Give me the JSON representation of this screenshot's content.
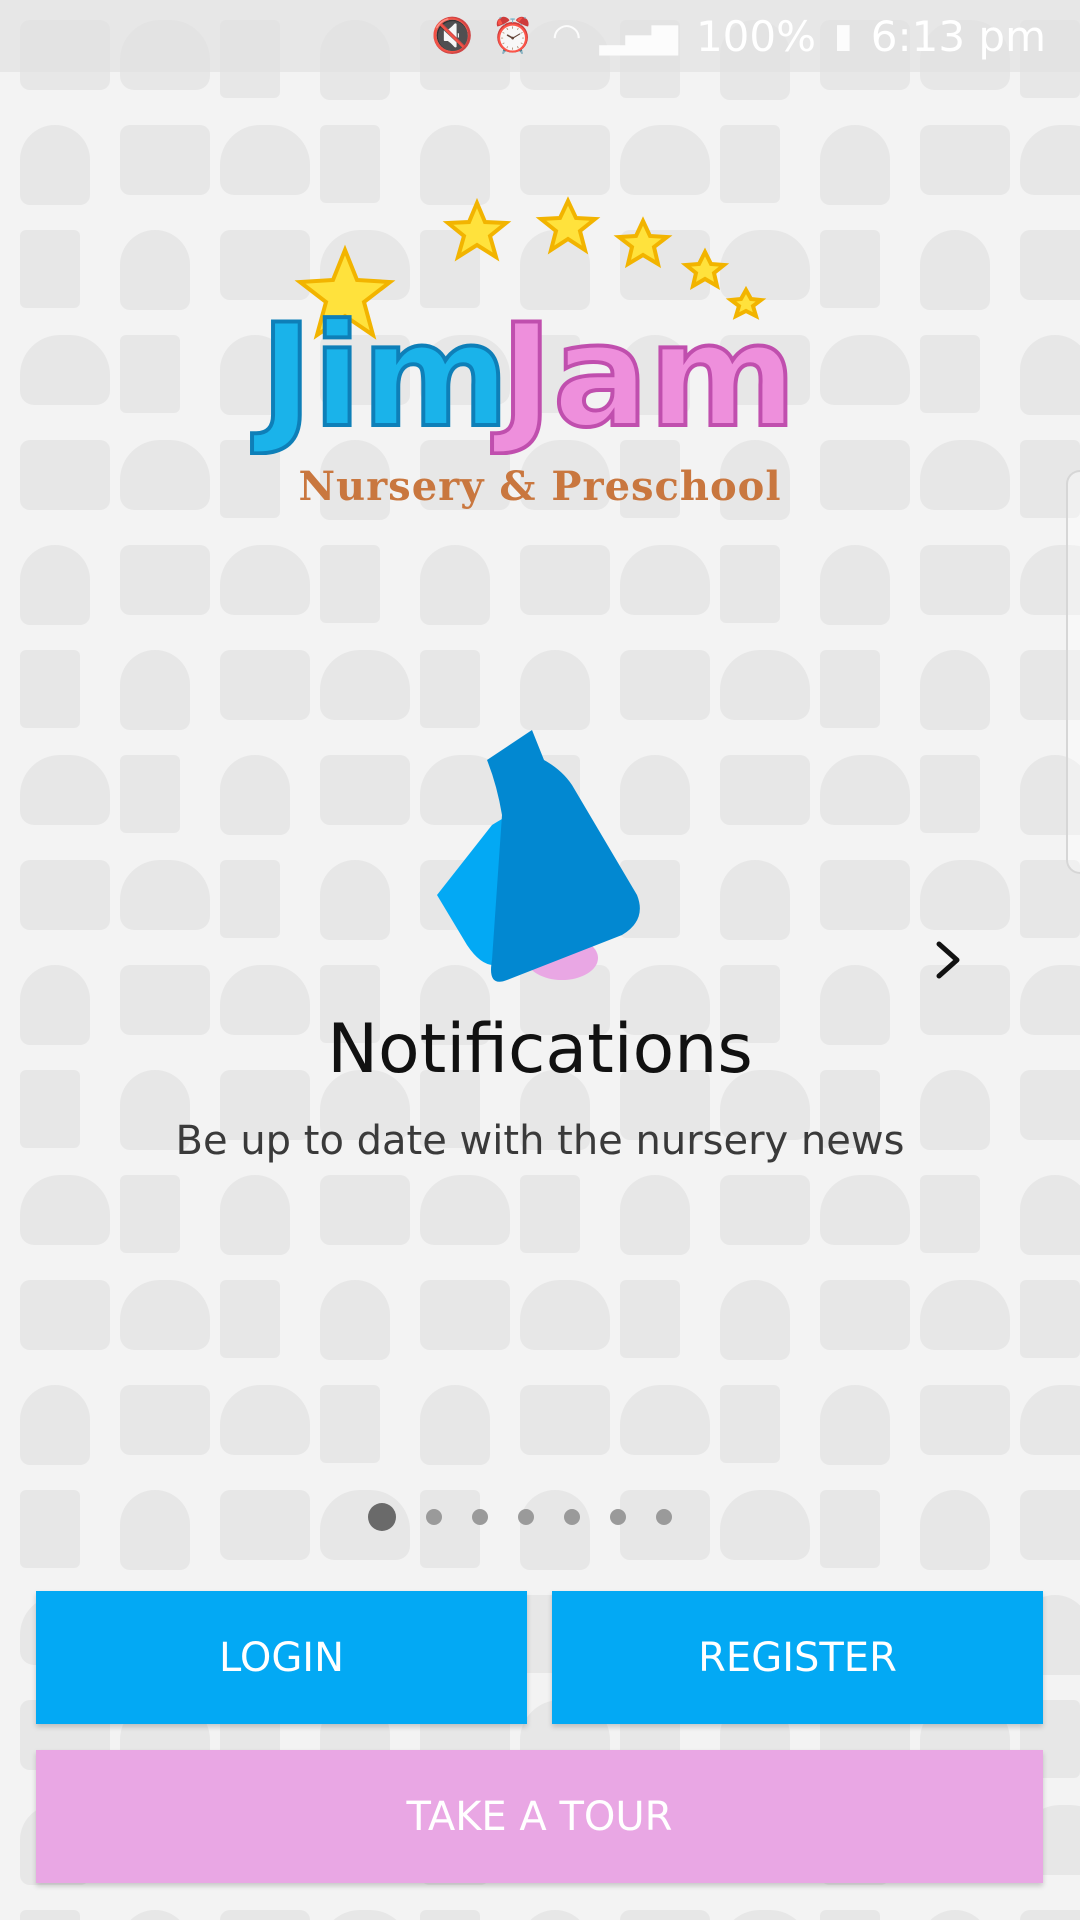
{
  "status_bar": {
    "battery": "100%",
    "time": "6:13 pm",
    "icons": [
      "mute-icon",
      "alarm-icon",
      "wifi-icon",
      "signal-icon",
      "battery-icon"
    ]
  },
  "logo": {
    "name_part1": "Jim",
    "name_part2": "Jam",
    "subtitle": "Nursery & Preschool",
    "colors": {
      "part1": "#1ab3ea",
      "part2": "#ee8fdc",
      "stars": "#ffe23c",
      "subtitle": "#c9773f"
    }
  },
  "slide": {
    "icon": "bell-icon",
    "title": "Notifications",
    "subtitle": "Be up to date with the nursery news",
    "total_pages": 7,
    "current_page": 1
  },
  "buttons": {
    "login": "LOGIN",
    "register": "REGISTER",
    "tour": "TAKE A TOUR"
  },
  "colors": {
    "primary": "#03a9f4",
    "tour": "#e9a7e4"
  }
}
